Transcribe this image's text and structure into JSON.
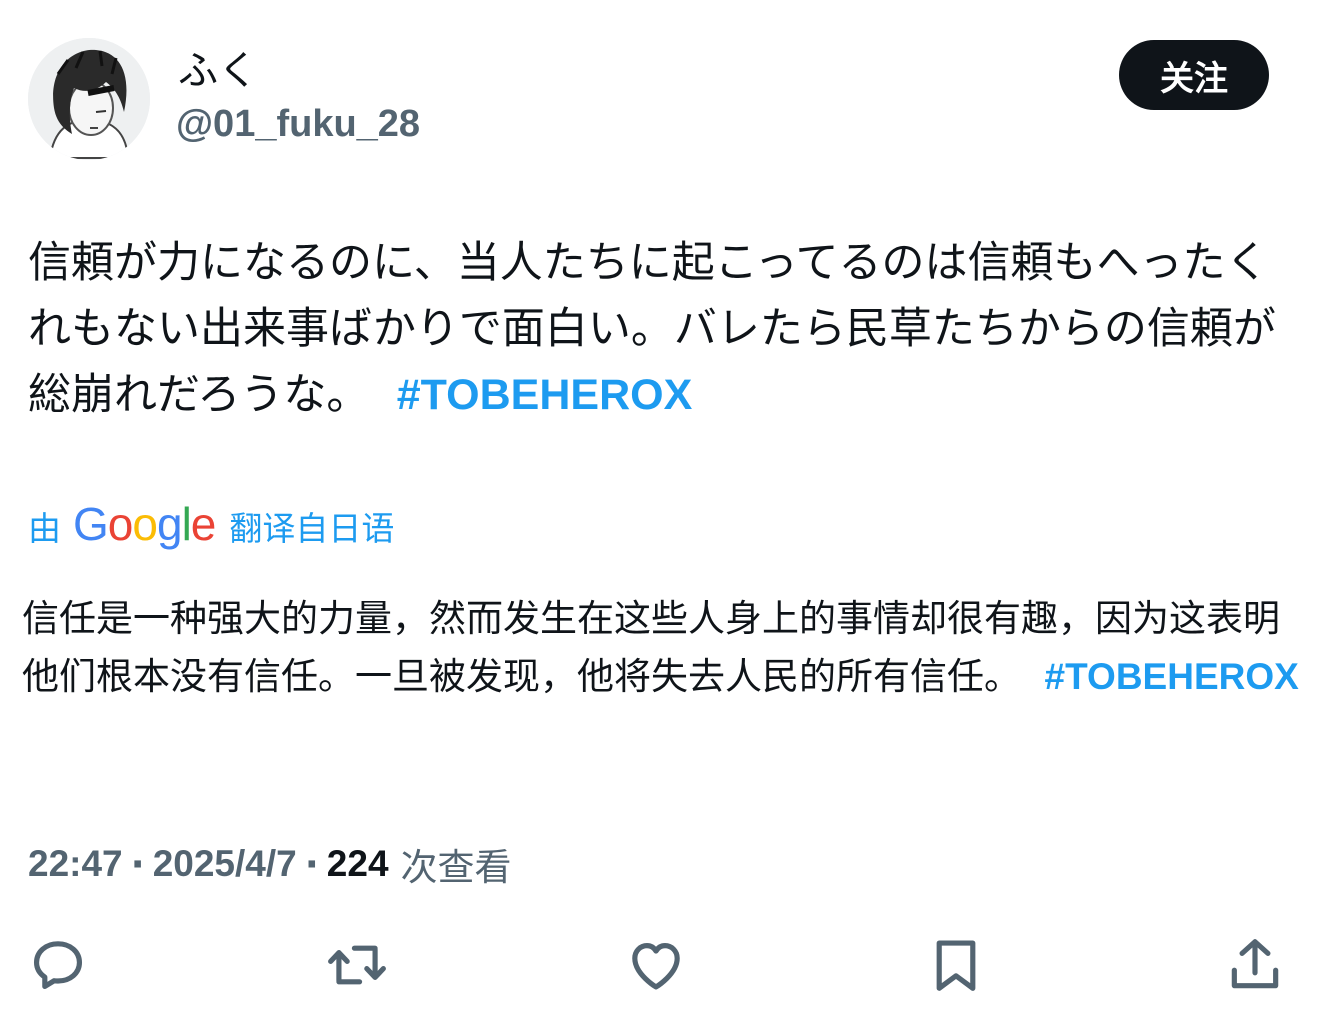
{
  "tweet": {
    "author": {
      "display_name": "ふく",
      "handle": "@01_fuku_28"
    },
    "follow_label": "关注",
    "text": "信頼が力になるのに、当人たちに起こってるのは信頼もへったくれもない出来事ばかりで面白い。バレたら民草たちからの信頼が総崩れだろうな。",
    "hashtag": "#TOBEHEROX",
    "translation": {
      "prefix": "由",
      "provider": "Google",
      "suffix": "翻译自日语",
      "text": "信任是一种强大的力量，然而发生在这些人身上的事情却很有趣，因为这表明他们根本没有信任。一旦被发现，他将失去人民的所有信任。",
      "hashtag": "#TOBEHEROX"
    },
    "meta": {
      "time": "22:47",
      "separator": "·",
      "date": "2025/4/7",
      "view_count": "224",
      "view_label": "次查看"
    },
    "actions": {
      "icons": [
        "reply-icon",
        "retweet-icon",
        "like-icon",
        "bookmark-icon",
        "share-icon"
      ]
    }
  },
  "colors": {
    "text": "#0f1419",
    "secondary": "#536471",
    "link": "#1d9bf0",
    "button_bg": "#0f1419"
  }
}
